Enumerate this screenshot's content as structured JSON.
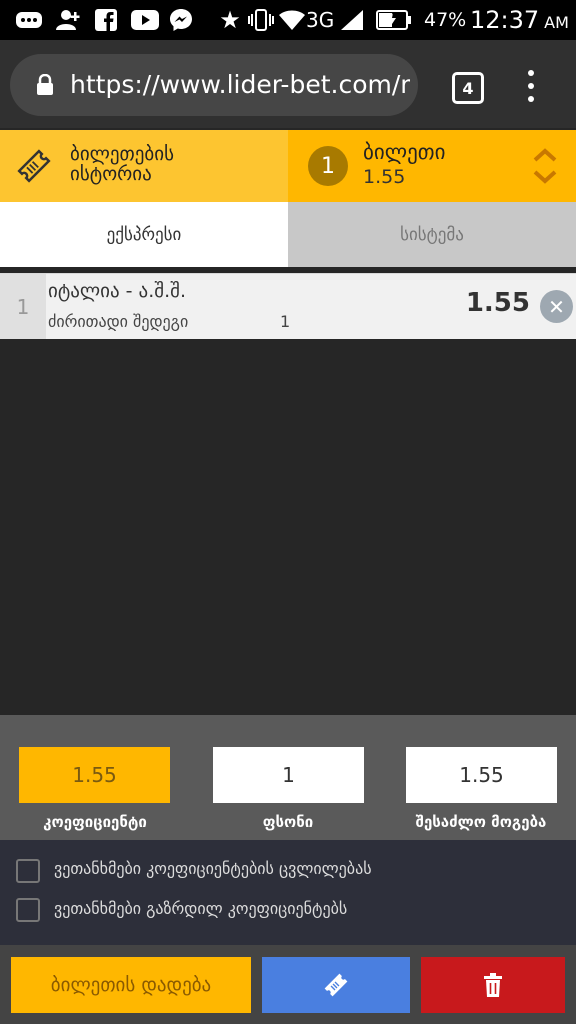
{
  "status_bar": {
    "battery_pct": "47%",
    "time": "12:37",
    "ampm": "AM",
    "network": "3G"
  },
  "browser": {
    "url": "https://www.lider-bet.com/m/lotto",
    "tab_count": "4"
  },
  "header": {
    "history_label_line1": "ბილეთების",
    "history_label_line2": "ისტორია",
    "ticket_badge": "1",
    "ticket_title": "ბილეთი",
    "ticket_odds": "1.55"
  },
  "tabs": [
    {
      "label": "ექსპრესი",
      "active": true
    },
    {
      "label": "სისტემა",
      "active": false
    }
  ],
  "bets": [
    {
      "index": "1",
      "match": "იტალია - ა.შ.შ.",
      "market": "ძირითადი შედეგი",
      "outcome": "1",
      "odds": "1.55"
    }
  ],
  "calc": {
    "coef_value": "1.55",
    "coef_label": "კოეფიციენტი",
    "stake_value": "1",
    "stake_label": "ფსონი",
    "win_value": "1.55",
    "win_label": "შესაძლო მოგება"
  },
  "options": [
    {
      "label": "ვეთანხმები კოეფიციენტების ცვლილებას",
      "checked": false
    },
    {
      "label": "ვეთანხმები გაზრდილ კოეფიციენტებს",
      "checked": false
    }
  ],
  "actions": {
    "place_label": "ბილეთის დადება"
  },
  "colors": {
    "accent": "#ffb700",
    "blue": "#4a7fe0",
    "red": "#c8191c"
  }
}
